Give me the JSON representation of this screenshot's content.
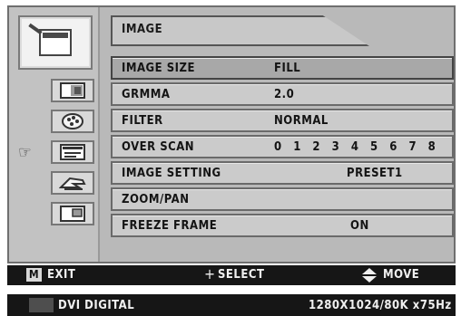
{
  "menu": {
    "title": "IMAGE",
    "rows": [
      {
        "label": "IMAGE SIZE",
        "value": "FILL"
      },
      {
        "label": "GRMMA",
        "value": "2.0"
      },
      {
        "label": "FILTER",
        "value": "NORMAL"
      },
      {
        "label": "OVER SCAN",
        "value": "0 1 2 3 4 5 6 7 8"
      },
      {
        "label": "IMAGE SETTING",
        "value": "PRESET1"
      },
      {
        "label": "ZOOM/PAN",
        "value": ""
      },
      {
        "label": "FREEZE FRAME",
        "value": "ON"
      }
    ]
  },
  "icons": {
    "selected": "image-settings-icon",
    "items": [
      "pattern-icon",
      "palette-icon",
      "image-list-icon",
      "hand-icon",
      "picture-in-picture-icon"
    ],
    "pointer": "pointing-hand-icon"
  },
  "controls": {
    "m_key": "M",
    "exit": "EXIT",
    "plus": "+",
    "select": "SELECT",
    "move": "MOVE"
  },
  "status": {
    "source": "DVI DIGITAL",
    "resolution": "1280X1024/80K x75Hz"
  },
  "colors": {
    "panel": "#b9b9b9",
    "row": "#cbcbcb",
    "selected_row": "#a8a8a8",
    "bar": "#161616"
  }
}
